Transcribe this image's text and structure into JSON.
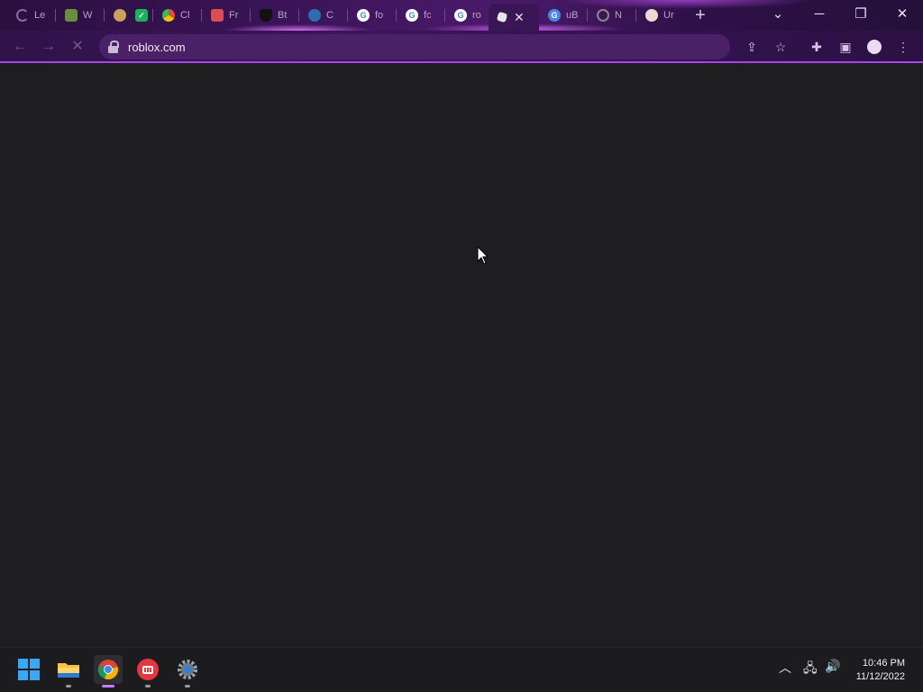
{
  "browser": {
    "tabs": [
      {
        "icon": "loading-spinner-icon",
        "title": "Le",
        "color": "#8a6aa0"
      },
      {
        "icon": "minecraft-block-icon",
        "title": "W",
        "color": "#6a8f3a"
      },
      {
        "icon": "colorful-app-icon",
        "title": "",
        "color": "#c9a15a"
      },
      {
        "icon": "checkmark-app-icon",
        "title": "",
        "color": "#19b35a"
      },
      {
        "icon": "chromium-icon",
        "title": "Cl",
        "color": "#e04e3a"
      },
      {
        "icon": "store-icon",
        "title": "Fr",
        "color": "#d94f4f"
      },
      {
        "icon": "shield-icon",
        "title": "Bt",
        "color": "#222222"
      },
      {
        "icon": "steam-icon",
        "title": "C",
        "color": "#2a6fb0"
      },
      {
        "icon": "google-icon",
        "title": "fo",
        "color": "#ffffff"
      },
      {
        "icon": "google-icon",
        "title": "fc",
        "color": "#ffffff"
      },
      {
        "icon": "google-icon",
        "title": "ro",
        "color": "#ffffff"
      },
      {
        "icon": "roblox-icon",
        "title": "",
        "color": "#e6e6e6",
        "active": true
      },
      {
        "icon": "google-translate-icon",
        "title": "uB",
        "color": "#4a86e8"
      },
      {
        "icon": "chrome-icon",
        "title": "N",
        "color": "#888888"
      },
      {
        "icon": "account-circle-icon",
        "title": "Ur",
        "color": "#e8dcd0"
      }
    ],
    "address": {
      "url": "roblox.com"
    },
    "accent_color": "#a845e8"
  },
  "taskbar": {
    "apps": [
      {
        "name": "windows-start",
        "icon": "windows-logo-icon",
        "active": false
      },
      {
        "name": "file-explorer",
        "icon": "folder-icon",
        "active": false
      },
      {
        "name": "google-chrome",
        "icon": "chrome-icon",
        "active": true
      },
      {
        "name": "riot-client",
        "icon": "riot-fist-icon",
        "active": false
      },
      {
        "name": "settings",
        "icon": "gear-icon",
        "active": false
      }
    ],
    "clock": {
      "time": "10:46 PM",
      "date": "11/12/2022"
    }
  }
}
